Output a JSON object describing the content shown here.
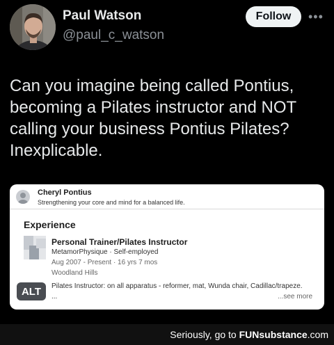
{
  "author": {
    "display_name": "Paul Watson",
    "handle": "@paul_c_watson"
  },
  "actions": {
    "follow_label": "Follow",
    "more_icon": "more-horizontal-icon"
  },
  "tweet": {
    "text": "Can you imagine being called Pontius,\nbecoming a Pilates instructor and NOT\ncalling your business Pontius Pilates?\nInexplicable."
  },
  "profile_card": {
    "name": "Cheryl Pontius",
    "tagline": "Strengthening your core and mind for a balanced life.",
    "section_title": "Experience",
    "job": {
      "title": "Personal Trainer/Pilates Instructor",
      "company": "MetamorPhysique · Self-employed",
      "dates": "Aug 2007 - Present · 16 yrs 7 mos",
      "location": "Woodland Hills",
      "description": "Pilates Instructor: on all apparatus - reformer, mat, Wunda chair, Cadillac/trapeze.",
      "ellipsis": "...",
      "see_more": "...see more"
    }
  },
  "media": {
    "alt_badge": "ALT"
  },
  "footer": {
    "prefix": "Seriously, go to ",
    "brand": "FUNsubstance",
    "suffix": ".com"
  },
  "colors": {
    "background": "#000000",
    "text_primary": "#e7e9ea",
    "text_secondary": "#8b9096",
    "follow_button": "#eff3f4"
  }
}
